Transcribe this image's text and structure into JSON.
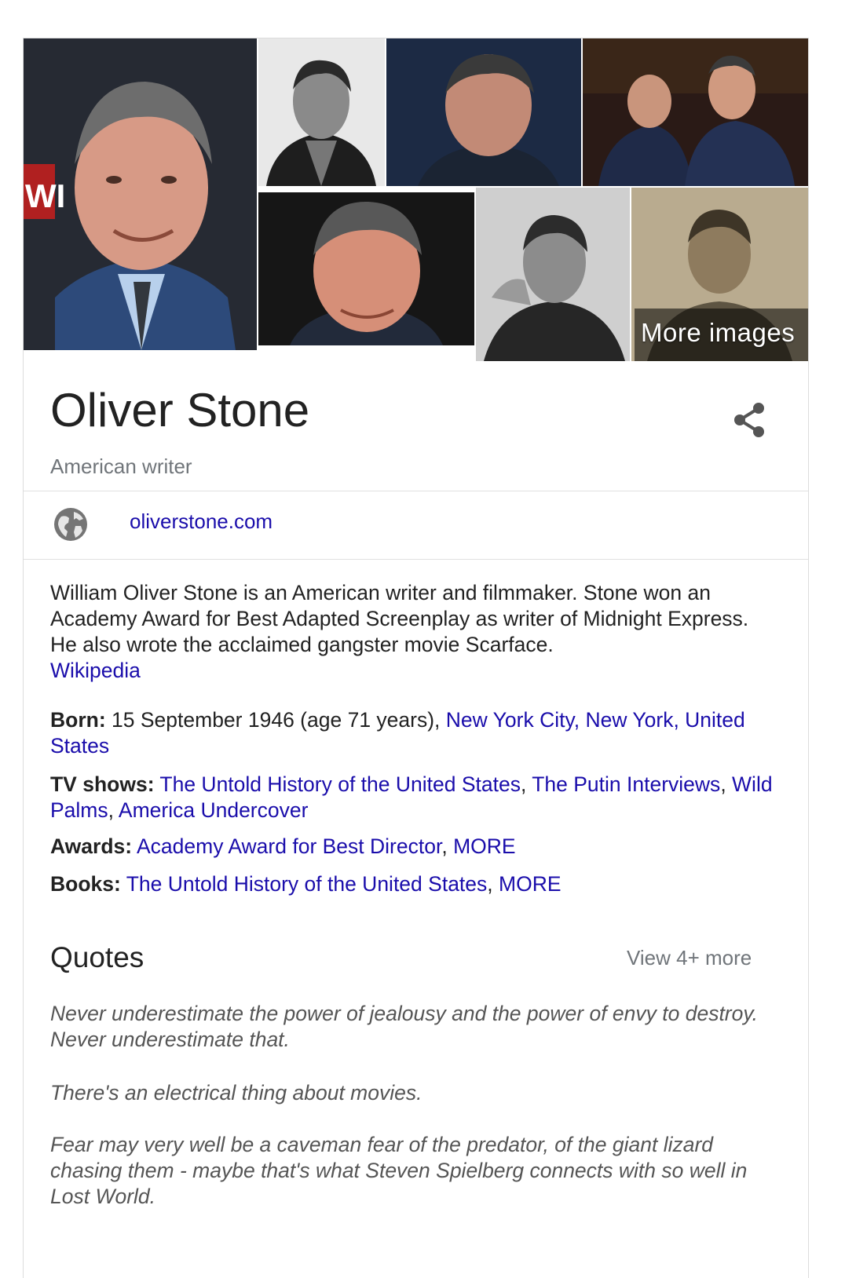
{
  "images": {
    "more_label": "More images"
  },
  "entity": {
    "name": "Oliver Stone",
    "subtitle": "American writer"
  },
  "website": {
    "label": "oliverstone.com"
  },
  "description": {
    "text": "William Oliver Stone is an American writer and filmmaker. Stone won an Academy Award for Best Adapted Screenplay as writer of Midnight Express. He also wrote the acclaimed gangster movie Scarface.",
    "source": "Wikipedia"
  },
  "facts": {
    "born": {
      "label": "Born:",
      "text": "15 September 1946 (age 71 years),",
      "place": "New York City, New York, United States"
    },
    "tv": {
      "label": "TV shows:",
      "items": [
        "The Untold History of the United States",
        "The Putin Interviews",
        "Wild Palms",
        "America Undercover"
      ]
    },
    "awards": {
      "label": "Awards:",
      "items": [
        "Academy Award for Best Director",
        "MORE"
      ]
    },
    "books": {
      "label": "Books:",
      "items": [
        "The Untold History of the United States",
        "MORE"
      ]
    }
  },
  "quotes": {
    "heading": "Quotes",
    "view_more": "View 4+ more",
    "items": [
      "Never underestimate the power of jealousy and the power of envy to destroy. Never underestimate that.",
      "There's an electrical thing about movies.",
      "Fear may very well be a caveman fear of the predator, of the giant lizard chasing them - maybe that's what Steven Spielberg connects with so well in Lost World."
    ]
  },
  "colors": {
    "link": "#1a0dab",
    "muted": "#70757a",
    "text": "#222222"
  }
}
